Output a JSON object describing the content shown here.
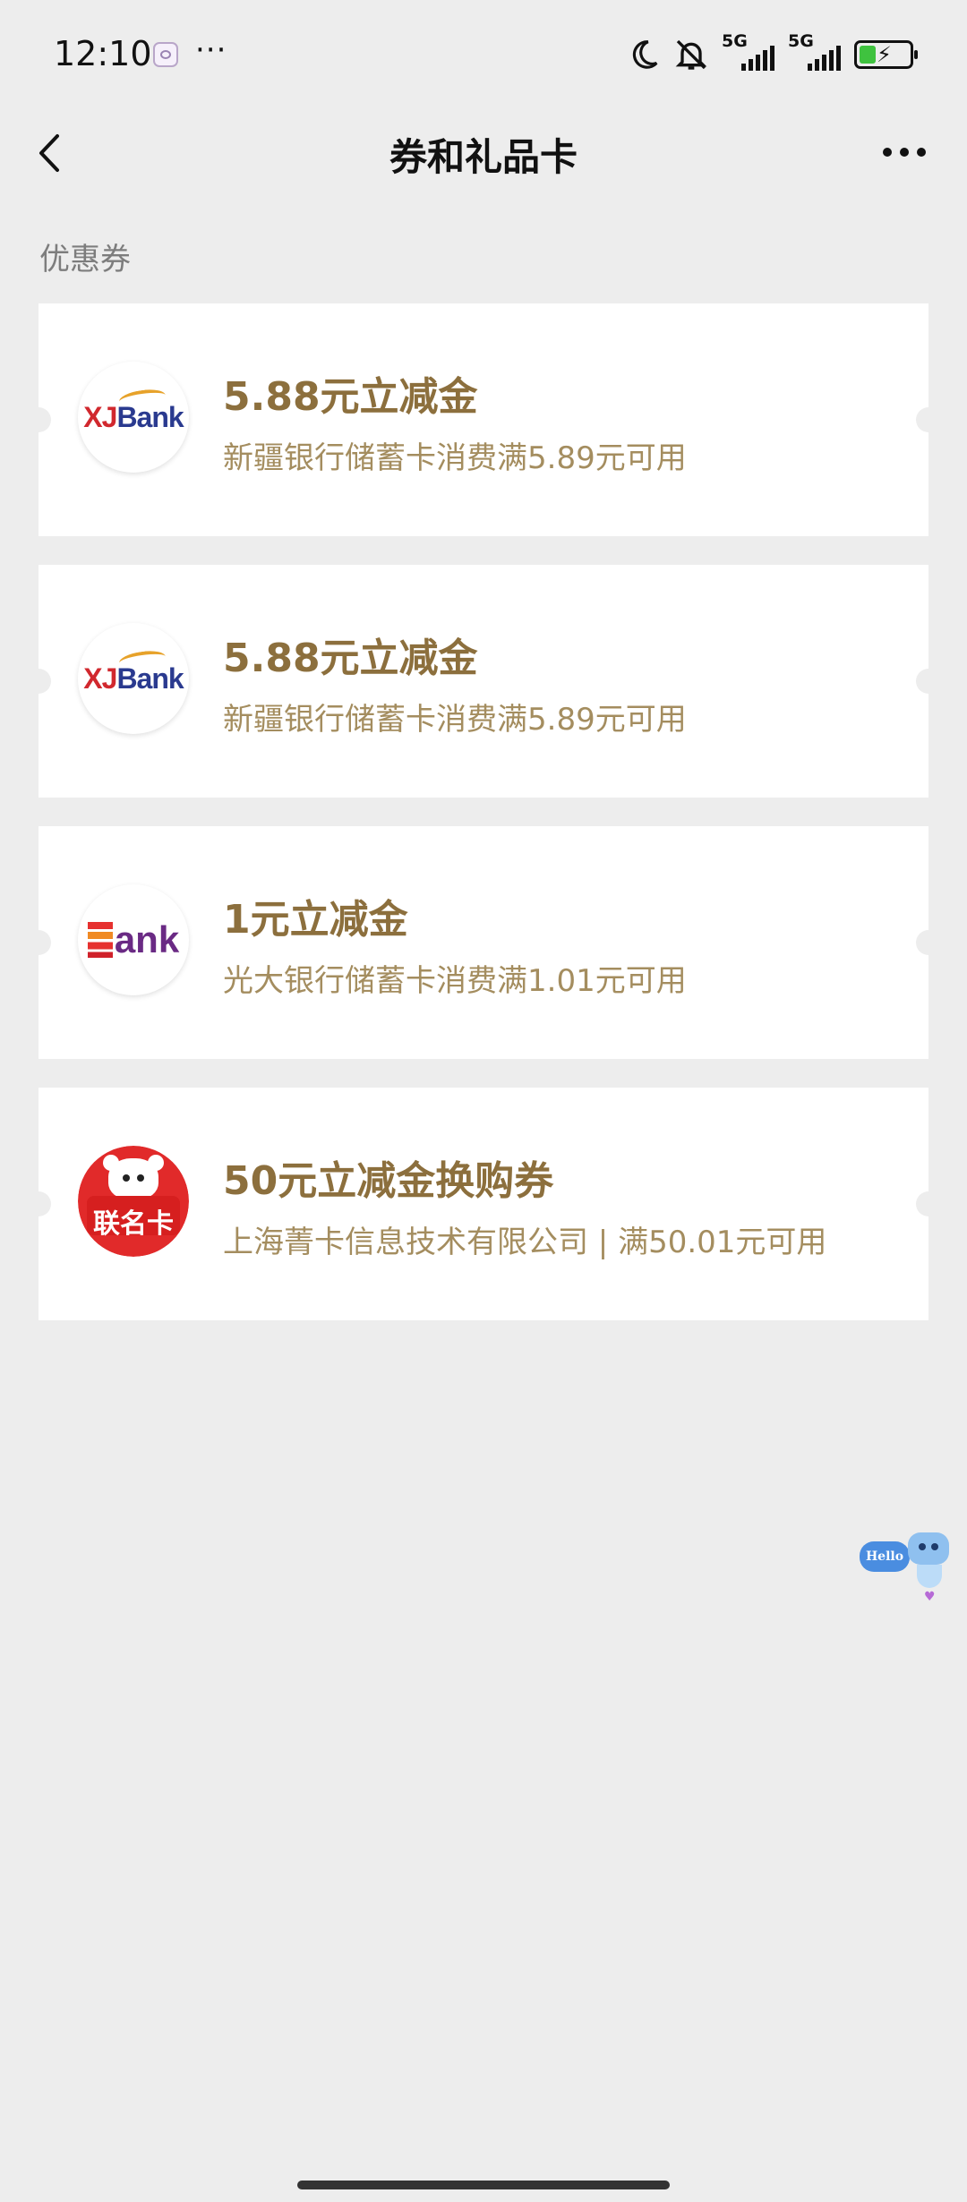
{
  "status_bar": {
    "time": "12:10",
    "overflow": "···",
    "signal1_label": "5G",
    "signal2_label": "5G"
  },
  "nav": {
    "title": "券和礼品卡"
  },
  "section_label": "优惠券",
  "coupons": [
    {
      "title": "5.88元立减金",
      "desc": "新疆银行储蓄卡消费满5.89元可用",
      "logo_icon": "xjbank-logo",
      "logo_text_x": "XJ",
      "logo_text_rest": "Bank"
    },
    {
      "title": "5.88元立减金",
      "desc": "新疆银行储蓄卡消费满5.89元可用",
      "logo_icon": "xjbank-logo",
      "logo_text_x": "XJ",
      "logo_text_rest": "Bank"
    },
    {
      "title": "1元立减金",
      "desc": "光大银行储蓄卡消费满1.01元可用",
      "logo_icon": "everbright-bank-logo",
      "logo_text_rest": "ank"
    },
    {
      "title": "50元立减金换购券",
      "desc": "上海菁卡信息技术有限公司 | 满50.01元可用",
      "logo_icon": "jd-cobrand-card-logo",
      "logo_text": "联名卡"
    }
  ],
  "floating_assistant": {
    "bubble_text": "Hello"
  },
  "colors": {
    "background": "#ededed",
    "card": "#ffffff",
    "coupon_title": "#8c6f3d",
    "coupon_desc": "#a48d5f"
  }
}
